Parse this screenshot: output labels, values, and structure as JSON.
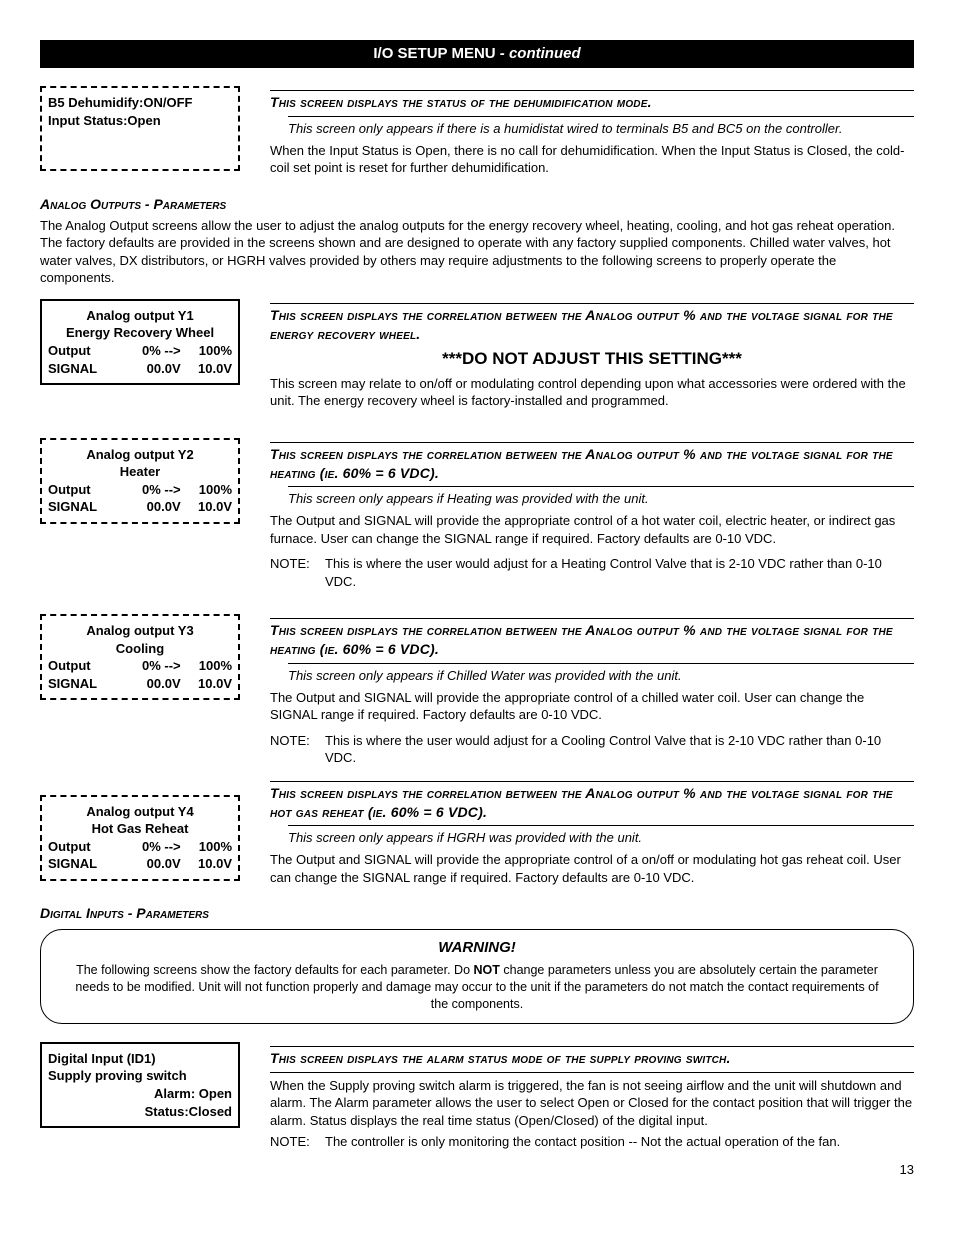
{
  "title": "I/O SETUP MENU",
  "title_cont": " - continued",
  "page_number": "13",
  "lcd_b5": {
    "l1": "B5 Dehumidify:ON/OFF",
    "l2": "Input Status:Open"
  },
  "b5": {
    "head": "This screen displays the status of the dehumidification mode.",
    "ital": "This screen only appears if there is a humidistat wired to terminals B5 and BC5 on the controller.",
    "para": "When the Input Status is Open, there is no call for dehumidification. When the Input Status is Closed, the cold-coil set point is reset for further dehumidification."
  },
  "analog_sub": "Analog Outputs - Parameters",
  "analog_intro": "The Analog Output screens allow the user to adjust the analog outputs for the energy recovery wheel, heating, cooling, and hot gas reheat operation. The factory defaults are provided in the screens shown and are designed to operate with any factory supplied components. Chilled water valves, hot water valves, DX distributors, or HGRH valves provided by others may require adjustments to the following screens to properly operate the components.",
  "lcd_y1": {
    "t1": "Analog output Y1",
    "t2": "Energy Recovery Wheel",
    "out_l": "Output",
    "out_m": "0% -->",
    "out_r": "100%",
    "sig_l": "SIGNAL",
    "sig_m": "00.0V",
    "sig_r": "10.0V"
  },
  "y1": {
    "head": "This screen displays the correlation between the Analog output % and the voltage signal for the energy recovery wheel.",
    "dna": "***DO NOT ADJUST THIS SETTING***",
    "para": "This screen may relate to on/off or modulating control depending upon what accessories were ordered with the unit. The energy recovery wheel is factory-installed and programmed."
  },
  "lcd_y2": {
    "t1": "Analog output Y2",
    "t2": "Heater",
    "out_l": "Output",
    "out_m": "0% -->",
    "out_r": "100%",
    "sig_l": "SIGNAL",
    "sig_m": "00.0V",
    "sig_r": "10.0V"
  },
  "y2": {
    "head": "This screen displays the correlation between the Analog output % and the voltage signal for the heating (ie. 60% = 6 VDC).",
    "ital": "This screen only appears if Heating was provided with the unit.",
    "para": "The Output and SIGNAL will provide the appropriate control of a hot water coil, electric heater, or indirect gas furnace. User can change the SIGNAL range if required. Factory defaults are 0-10 VDC.",
    "note_l": "NOTE:",
    "note_t": "This is where the user would adjust for a Heating Control Valve that is 2-10 VDC rather than 0-10 VDC."
  },
  "lcd_y3": {
    "t1": "Analog output Y3",
    "t2": "Cooling",
    "out_l": "Output",
    "out_m": "0% -->",
    "out_r": "100%",
    "sig_l": "SIGNAL",
    "sig_m": "00.0V",
    "sig_r": "10.0V"
  },
  "y3": {
    "head": "This screen displays the correlation between the Analog output % and the voltage signal for the heating (ie. 60% = 6 VDC).",
    "ital": "This screen only appears if Chilled Water was provided with the unit.",
    "para": "The Output and SIGNAL will provide the appropriate control of a chilled water coil. User can change the SIGNAL range if required. Factory defaults are 0-10 VDC.",
    "note_l": "NOTE:",
    "note_t": "This is where the user would adjust for a Cooling Control Valve that is 2-10 VDC rather than 0-10 VDC."
  },
  "lcd_y4": {
    "t1": "Analog output Y4",
    "t2": "Hot Gas Reheat",
    "out_l": "Output",
    "out_m": "0% -->",
    "out_r": "100%",
    "sig_l": "SIGNAL",
    "sig_m": "00.0V",
    "sig_r": "10.0V"
  },
  "y4": {
    "head": "This screen displays the correlation between the Analog output % and the voltage signal for the hot gas reheat (ie. 60% = 6 VDC).",
    "ital": "This screen only appears if HGRH was provided with the unit.",
    "para": "The Output and SIGNAL will provide the appropriate control of a on/off or modulating hot gas reheat coil. User can change the SIGNAL range if required. Factory defaults are 0-10 VDC."
  },
  "digital_sub": "Digital Inputs - Parameters",
  "warning": {
    "title": "WARNING!",
    "pre": "The following screens show the factory defaults for each parameter. Do ",
    "not": "NOT",
    "post": " change parameters unless you are absolutely certain the parameter needs to be modified. Unit will not function properly and damage may occur to the unit if the parameters do not match the contact requirements of the components."
  },
  "lcd_id1": {
    "l1": "Digital Input (ID1)",
    "l2": "Supply proving switch",
    "l3": "Alarm: Open",
    "l4": "Status:Closed"
  },
  "id1": {
    "head": "This screen displays the alarm status mode of the supply proving switch.",
    "para": "When the Supply proving switch alarm is triggered, the fan is not seeing airflow and the unit will shutdown and alarm. The Alarm parameter allows the user to select Open or Closed for the contact position that will trigger the alarm. Status displays the real time status (Open/Closed) of the digital input.",
    "note_l": "NOTE:",
    "note_t": "The controller is only monitoring the contact position -- Not the actual operation of the fan."
  }
}
